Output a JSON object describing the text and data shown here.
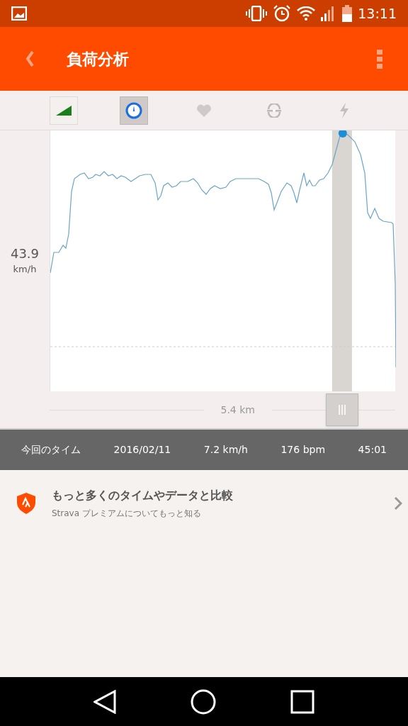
{
  "status_bar": {
    "time": "13:11"
  },
  "header": {
    "title": "負荷分析"
  },
  "metrics": [
    {
      "kind": "elevation",
      "selected": false
    },
    {
      "kind": "speed",
      "selected": true
    },
    {
      "kind": "heart",
      "selected": false
    },
    {
      "kind": "cadence",
      "selected": false
    },
    {
      "kind": "power",
      "selected": false
    }
  ],
  "reading": {
    "value": "43.9",
    "unit": "km/h"
  },
  "distance": {
    "label": "5.4 km",
    "level": 0.846
  },
  "stats": {
    "label": "今回のタイム",
    "date": "2016/02/11",
    "speed": "7.2 km/h",
    "heart_rate": "176 bpm",
    "time": "45:01"
  },
  "promo": {
    "title": "もっと多くのタイムやデータと比較",
    "subtitle": "Strava プレミアムについてもっと知る"
  }
}
